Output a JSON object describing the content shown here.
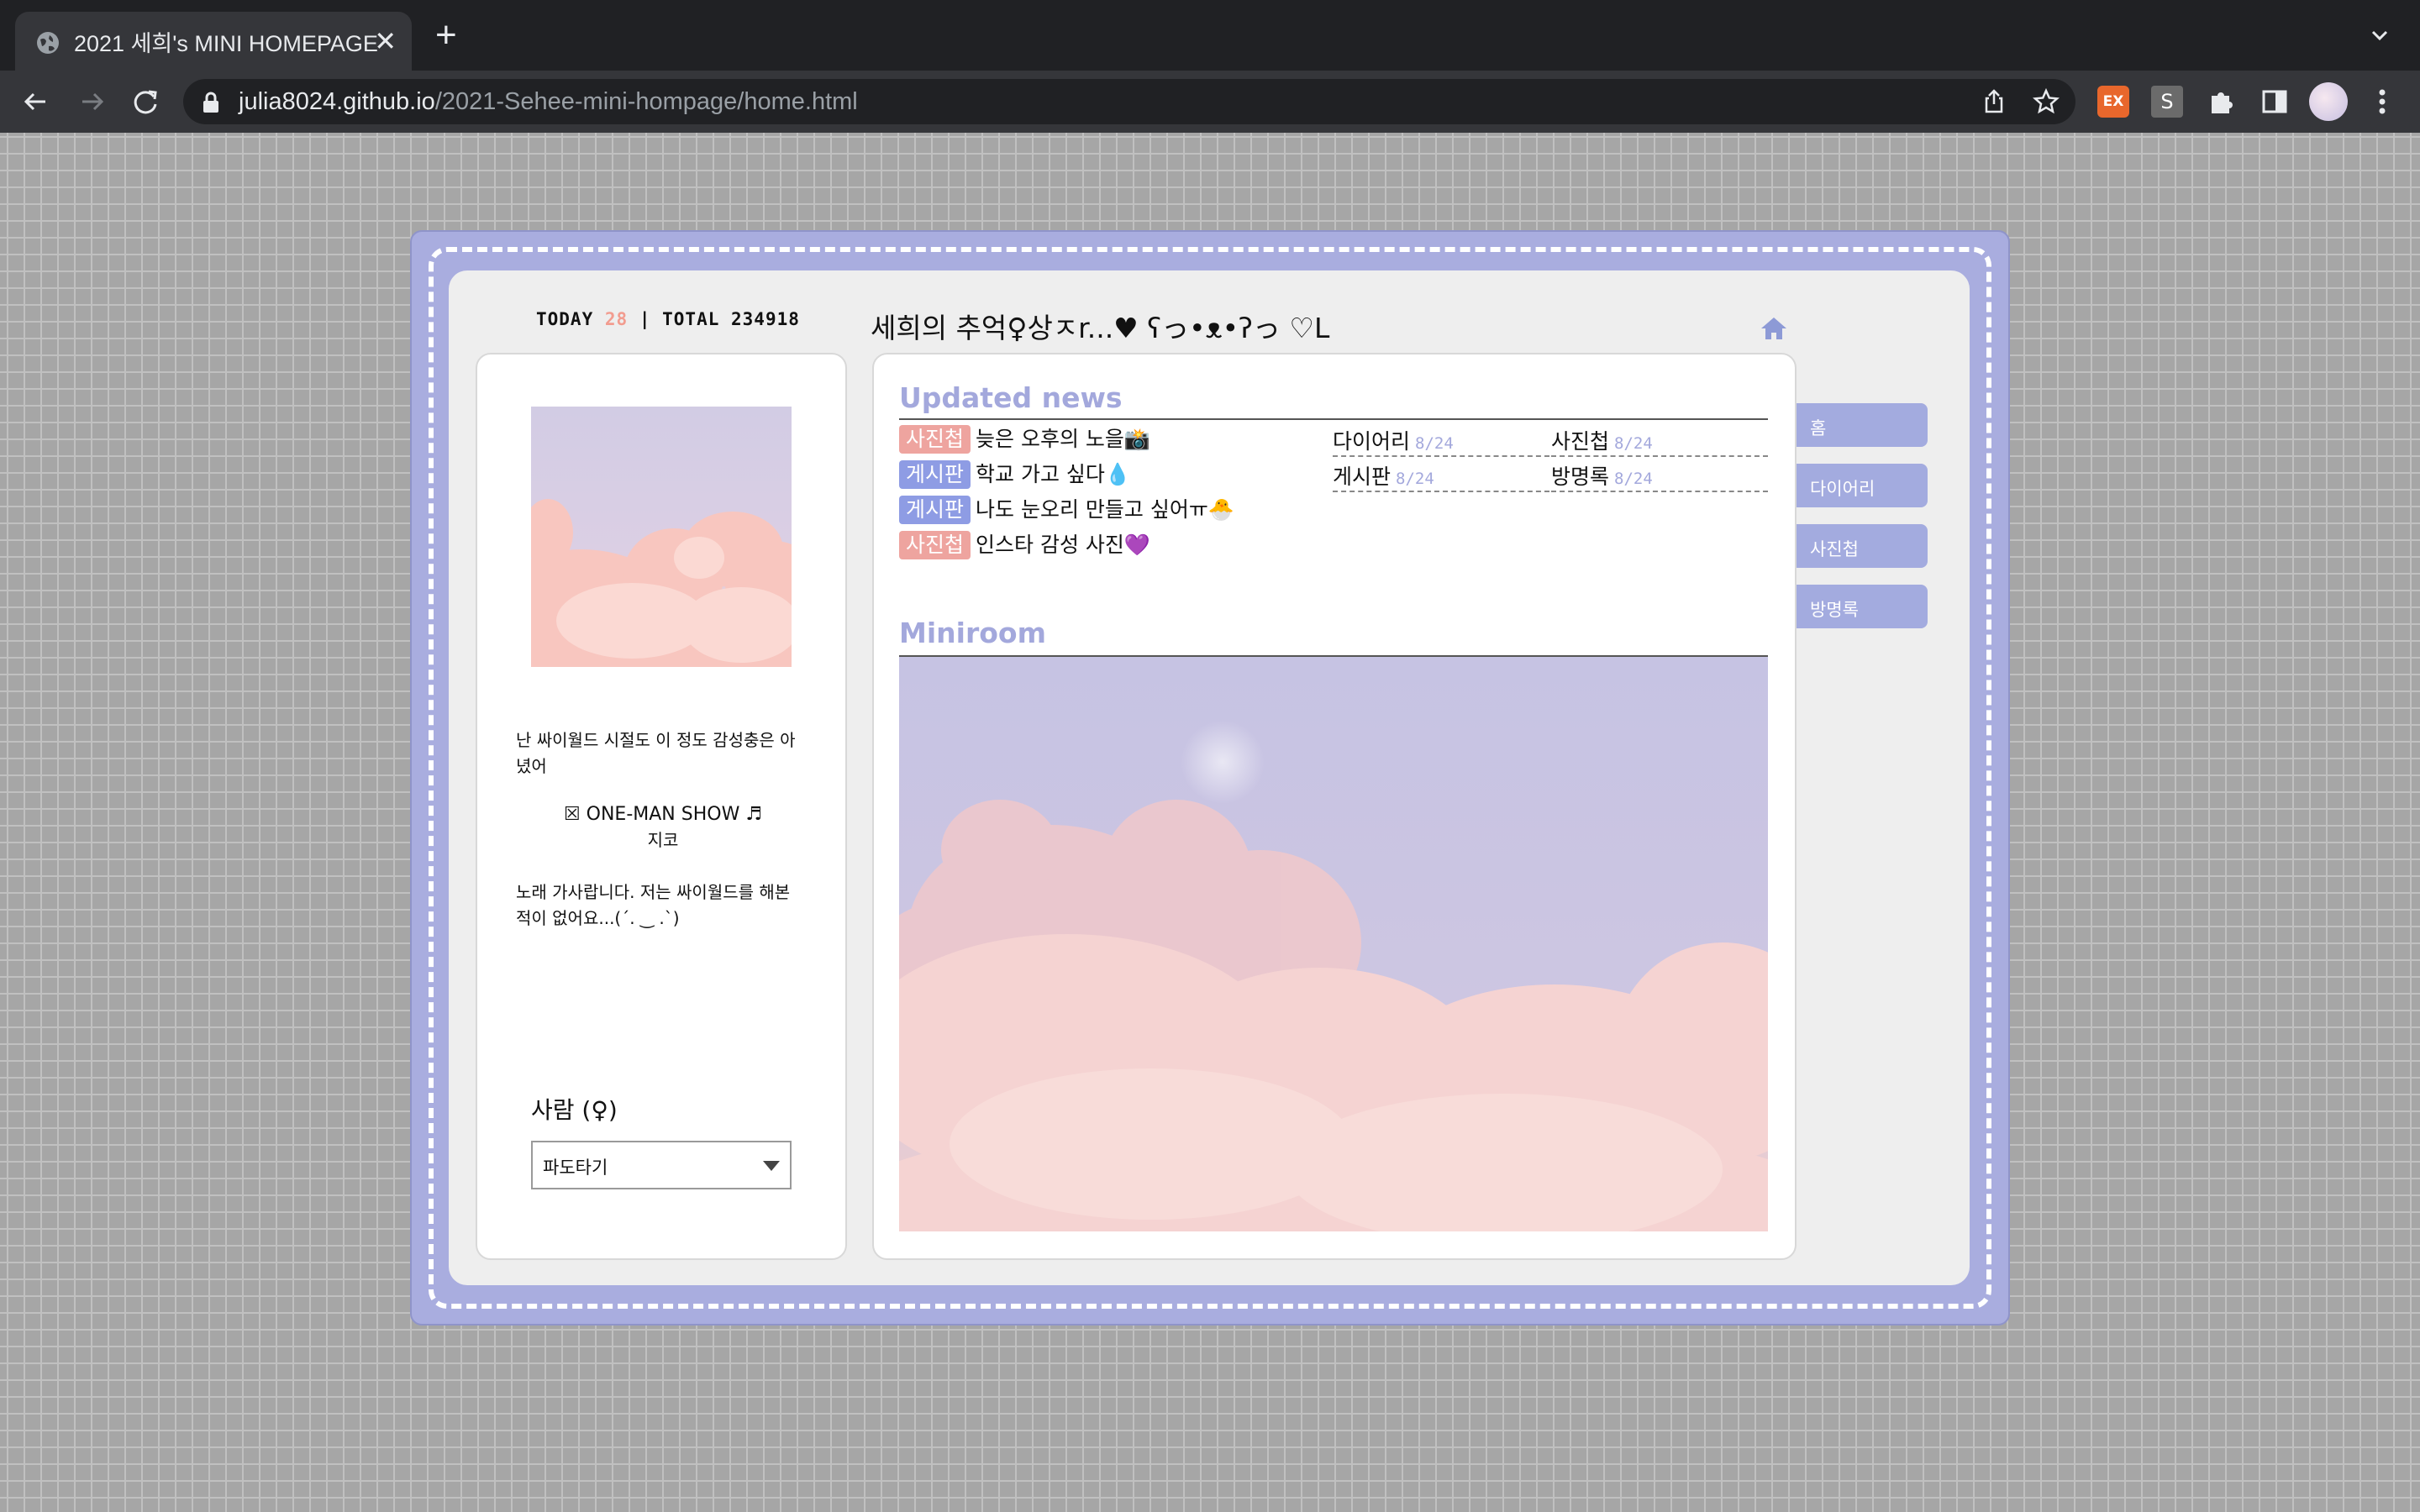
{
  "browser": {
    "tab_title": "2021 세희's MINI HOMEPAGE",
    "new_tab": "+",
    "close": "✕",
    "url_host": "julia8024.github.io",
    "url_path": "/2021-Sehee-mini-hompage/home.html",
    "extensions": {
      "ex_label": "EX",
      "s_label": "S"
    }
  },
  "header": {
    "today_label": "TODAY",
    "today_count": "28",
    "separator": "|",
    "total_label": "TOTAL",
    "total_count": "234918",
    "site_title": "세희의 추억♀상ㅈr...♥ ʕっ•ᴥ•ʔっ ♡L"
  },
  "profile": {
    "bio_line1": "난 싸이월드 시절도 이 정도 감성충은 아녔어",
    "song_title": "☒ ONE-MAN SHOW ♬",
    "song_artist": "지코",
    "bio_line3": "노래 가사랍니다. 저는 싸이월드를 해본 적이 없어요...(´. ‿ .`)",
    "mood_label": "사람 (♀)",
    "mood_selected": "파도타기"
  },
  "news": {
    "title": "Updated news",
    "items": [
      {
        "tag": "사진첩",
        "text": "늦은 오후의 노을📸"
      },
      {
        "tag": "게시판",
        "text": "학교 가고 싶다💧"
      },
      {
        "tag": "게시판",
        "text": "나도 눈오리 만들고 싶어ㅠ🐣"
      },
      {
        "tag": "사진첩",
        "text": "인스타 감성 사진💜"
      }
    ],
    "stats": [
      {
        "label": "다이어리",
        "date": "8/24"
      },
      {
        "label": "사진첩",
        "date": "8/24"
      },
      {
        "label": "게시판",
        "date": "8/24"
      },
      {
        "label": "방명록",
        "date": "8/24"
      }
    ]
  },
  "miniroom": {
    "title": "Miniroom"
  },
  "menu": {
    "items": [
      "홈",
      "다이어리",
      "사진첩",
      "방명록"
    ]
  },
  "colors": {
    "accent": "#a3a8dc",
    "menu_bg": "#a3abdf",
    "tag_photo": "#eea49f",
    "tag_board": "#8e9ce4",
    "today_count": "#f29c8f",
    "frame": "#a9addf"
  },
  "icons": {
    "tab": "globe-icon",
    "back": "back-arrow-icon",
    "forward": "forward-arrow-icon",
    "reload": "reload-icon",
    "lock": "lock-icon",
    "share": "share-icon",
    "bookmark": "star-icon",
    "home": "home-icon"
  }
}
